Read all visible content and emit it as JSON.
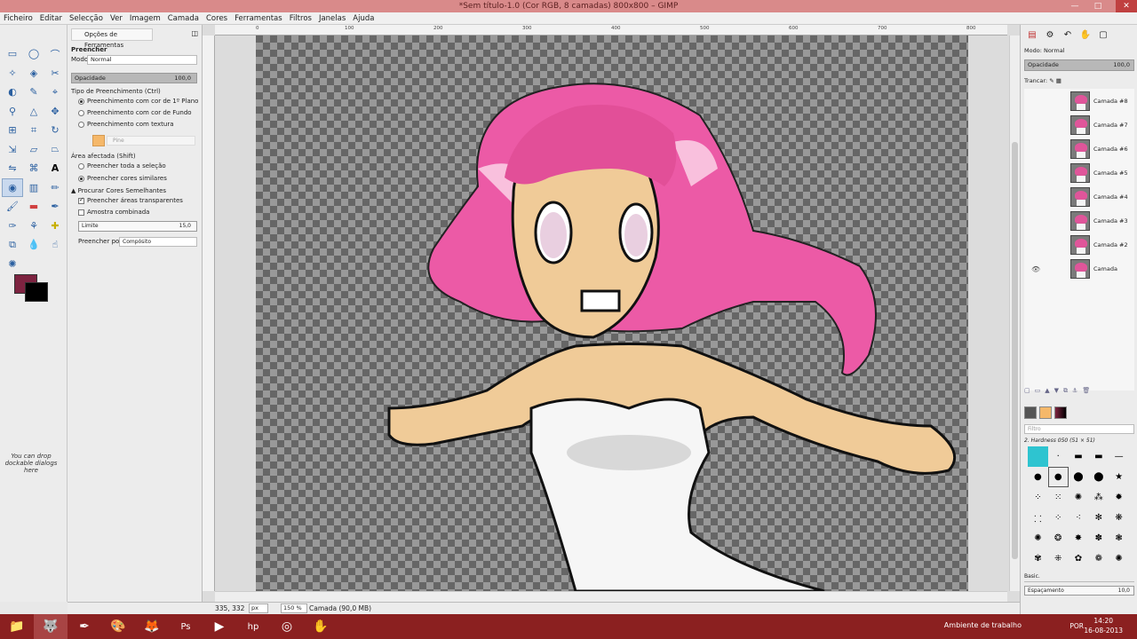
{
  "window": {
    "title": "*Sem título-1.0 (Cor RGB, 8 camadas) 800x800 – GIMP"
  },
  "menu": [
    "Ficheiro",
    "Editar",
    "Selecção",
    "Ver",
    "Imagem",
    "Camada",
    "Cores",
    "Ferramentas",
    "Filtros",
    "Janelas",
    "Ajuda"
  ],
  "toolbox": {
    "fg_color": "#7d2340",
    "bg_color": "#000000",
    "dock_hint": "You can drop dockable dialogs here"
  },
  "tool_options": {
    "tab_label": "Opções de Ferramentas",
    "tool_name": "Preencher",
    "mode_label": "Modo:",
    "mode_value": "Normal",
    "opacity_label": "Opacidade",
    "opacity_value": "100,0",
    "fill_type_label": "Tipo de Preenchimento (Ctrl)",
    "fill_fg": "Preenchimento com cor de 1º Plano",
    "fill_bg": "Preenchimento com cor de Fundo",
    "fill_pattern": "Preenchimento com textura",
    "pattern_name": "Pine",
    "affected_label": "Área afectada (Shift)",
    "affected_selection": "Preencher toda a seleção",
    "affected_similar": "Preencher cores similares",
    "find_similar_label": "Procurar Cores Semelhantes",
    "fill_transparent": "Preencher áreas transparentes",
    "sample_merged": "Amostra combinada",
    "threshold_label": "Limite",
    "threshold_value": "15,0",
    "fill_by_label": "Preencher por",
    "fill_by_value": "Compósito"
  },
  "rulers": {
    "top_ticks": [
      "0",
      "100",
      "200",
      "300",
      "400",
      "500",
      "600",
      "700",
      "800"
    ]
  },
  "status": {
    "coords": "335, 332",
    "unit": "px",
    "zoom": "150 %",
    "message": "Camada (90,0 MB)"
  },
  "layers": {
    "mode_label": "Modo:",
    "mode_value": "Normal",
    "opacity_label": "Opacidade",
    "opacity_value": "100,0",
    "lock_label": "Trancar:",
    "items": [
      {
        "name": "Camada #8"
      },
      {
        "name": "Camada #7"
      },
      {
        "name": "Camada #6"
      },
      {
        "name": "Camada #5"
      },
      {
        "name": "Camada #4"
      },
      {
        "name": "Camada #3"
      },
      {
        "name": "Camada #2"
      },
      {
        "name": "Camada"
      }
    ]
  },
  "brushes": {
    "filter_placeholder": "Filtro",
    "current_brush": "2. Hardness 050 (51 × 51)",
    "preset": "Basic.",
    "spacing_label": "Espaçamento",
    "spacing_value": "10,0"
  },
  "taskbar": {
    "desktop_label": "Ambiente de trabalho",
    "lang": "POR",
    "time": "14:20",
    "date": "16-08-2013"
  }
}
